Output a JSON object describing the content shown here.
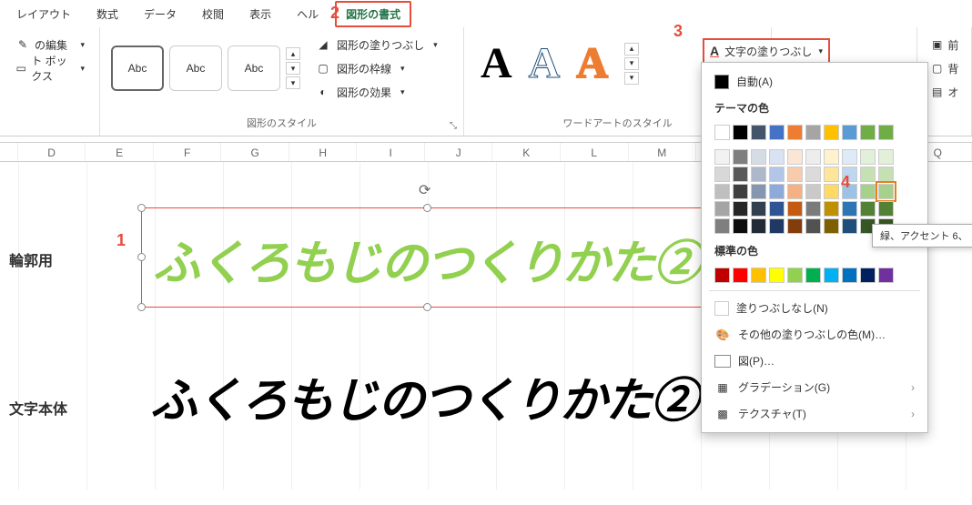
{
  "tabs": {
    "layout": "レイアウト",
    "formula": "数式",
    "data": "データ",
    "review": "校閲",
    "view": "表示",
    "help": "ヘル",
    "shape_format": "図形の書式"
  },
  "left_pane": {
    "edit": "の編集",
    "textbox": "ト ボックス"
  },
  "shape_group": {
    "label": "図形のスタイル",
    "abc": "Abc",
    "fill": "図形の塗りつぶし",
    "outline": "図形の枠線",
    "effect": "図形の効果"
  },
  "wordart_group": {
    "label": "ワードアートのスタイル"
  },
  "text_fill_btn": "文字の塗りつぶし",
  "right_pane": {
    "front": "前",
    "back": "背",
    "obj": "オ"
  },
  "columns": [
    "",
    "D",
    "E",
    "F",
    "G",
    "H",
    "I",
    "J",
    "K",
    "L",
    "M",
    "",
    "Q"
  ],
  "row_labels": {
    "r1": "輪郭用",
    "r2": "文字本体"
  },
  "wordart_text": "ふくろもじのつくりかた②",
  "picker": {
    "auto": "自動(A)",
    "theme": "テーマの色",
    "standard": "標準の色",
    "nofill": "塗りつぶしなし(N)",
    "more": "その他の塗りつぶしの色(M)…",
    "picture": "図(P)…",
    "gradient": "グラデーション(G)",
    "texture": "テクスチャ(T)"
  },
  "tooltip": "緑、アクセント 6、",
  "callouts": {
    "c1": "1",
    "c2": "2",
    "c3": "3",
    "c4": "4"
  }
}
